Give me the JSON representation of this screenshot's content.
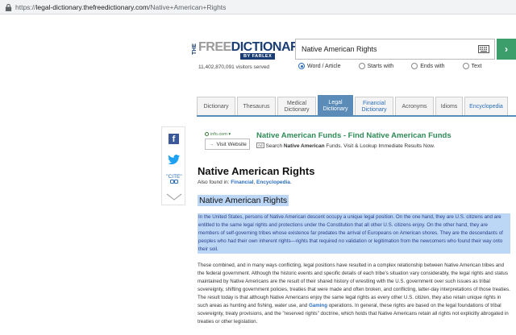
{
  "browser": {
    "url_scheme": "https://",
    "url_host": "legal-dictionary.thefreedictionary.com",
    "url_path": "/Native+American+Rights"
  },
  "header": {
    "logo_the": "THE",
    "logo_free": "FREE",
    "logo_dictionary": "DICTIONARY",
    "logo_byline": "BY FARLEX",
    "visitors": "11,402,870,091 visitors served",
    "search_value": "Native American Rights",
    "go_symbol": "›",
    "radio_options": [
      {
        "label": "Word / Article",
        "selected": true
      },
      {
        "label": "Starts with",
        "selected": false
      },
      {
        "label": "Ends with",
        "selected": false
      },
      {
        "label": "Text",
        "selected": false
      }
    ]
  },
  "tabs": [
    {
      "label": "Dictionary"
    },
    {
      "label": "Thesaurus"
    },
    {
      "label": "Medical Dictionary"
    },
    {
      "label": "Legal Dictionary"
    },
    {
      "label": "Financial Dictionary"
    },
    {
      "label": "Acronyms"
    },
    {
      "label": "Idioms"
    },
    {
      "label": "Encyclopedia"
    }
  ],
  "share": {
    "facebook_glyph": "f",
    "cite_label": "\"CITE\""
  },
  "ad": {
    "source": "info.com",
    "visit_label": "Visit Website",
    "title": "Native American Funds - Find Native American Funds",
    "badge": "Ad",
    "desc_pre": "Search ",
    "desc_bold": "Native American",
    "desc_post": " Funds. Visit & Lookup Immediate Results Now."
  },
  "article": {
    "title": "Native American Rights",
    "also_found_prefix": "Also found in: ",
    "also_found_links": [
      "Financial",
      "Encyclopedia"
    ],
    "heading": "Native American Rights",
    "para1": "In the United States, persons of Native American descent occupy a unique legal position. On the one hand, they are U.S. citizens and are entitled to the same legal rights and protections under the Constitution that all other U.S. citizens enjoy. On the other hand, they are members of self-governing tribes whose existence far predates the arrival of Europeans on American shores. They are the descendants of peoples who had their own inherent rights—rights that required no validation or legitimation from the newcomers who found their way onto their soil.",
    "para2_pre": "These combined, and in many ways conflicting, legal positions have resulted in a complex relationship between Native American tribes and the federal government. Although the historic events and specific details of each tribe's situation vary considerably, the legal rights and status maintained by Native Americans are the result of their shared history of wrestling with the U.S. government over such issues as tribal sovereignty, shifting government policies, treaties that were made and often broken, and conflicting, latter-day interpretations of those treaties. The result today is that although Native Americans enjoy the same legal rights as every other U.S. citizen, they also retain unique rights in such areas as hunting and fishing, water use, and ",
    "para2_link": "Gaming",
    "para2_post": " operations. In general, these rights are based on the legal foundations of tribal sovereignty, treaty provisions, and the \"reserved rights\" doctrine, which holds that Native Americans retain all rights not explicitly abrogated in treaties or other legislation."
  }
}
